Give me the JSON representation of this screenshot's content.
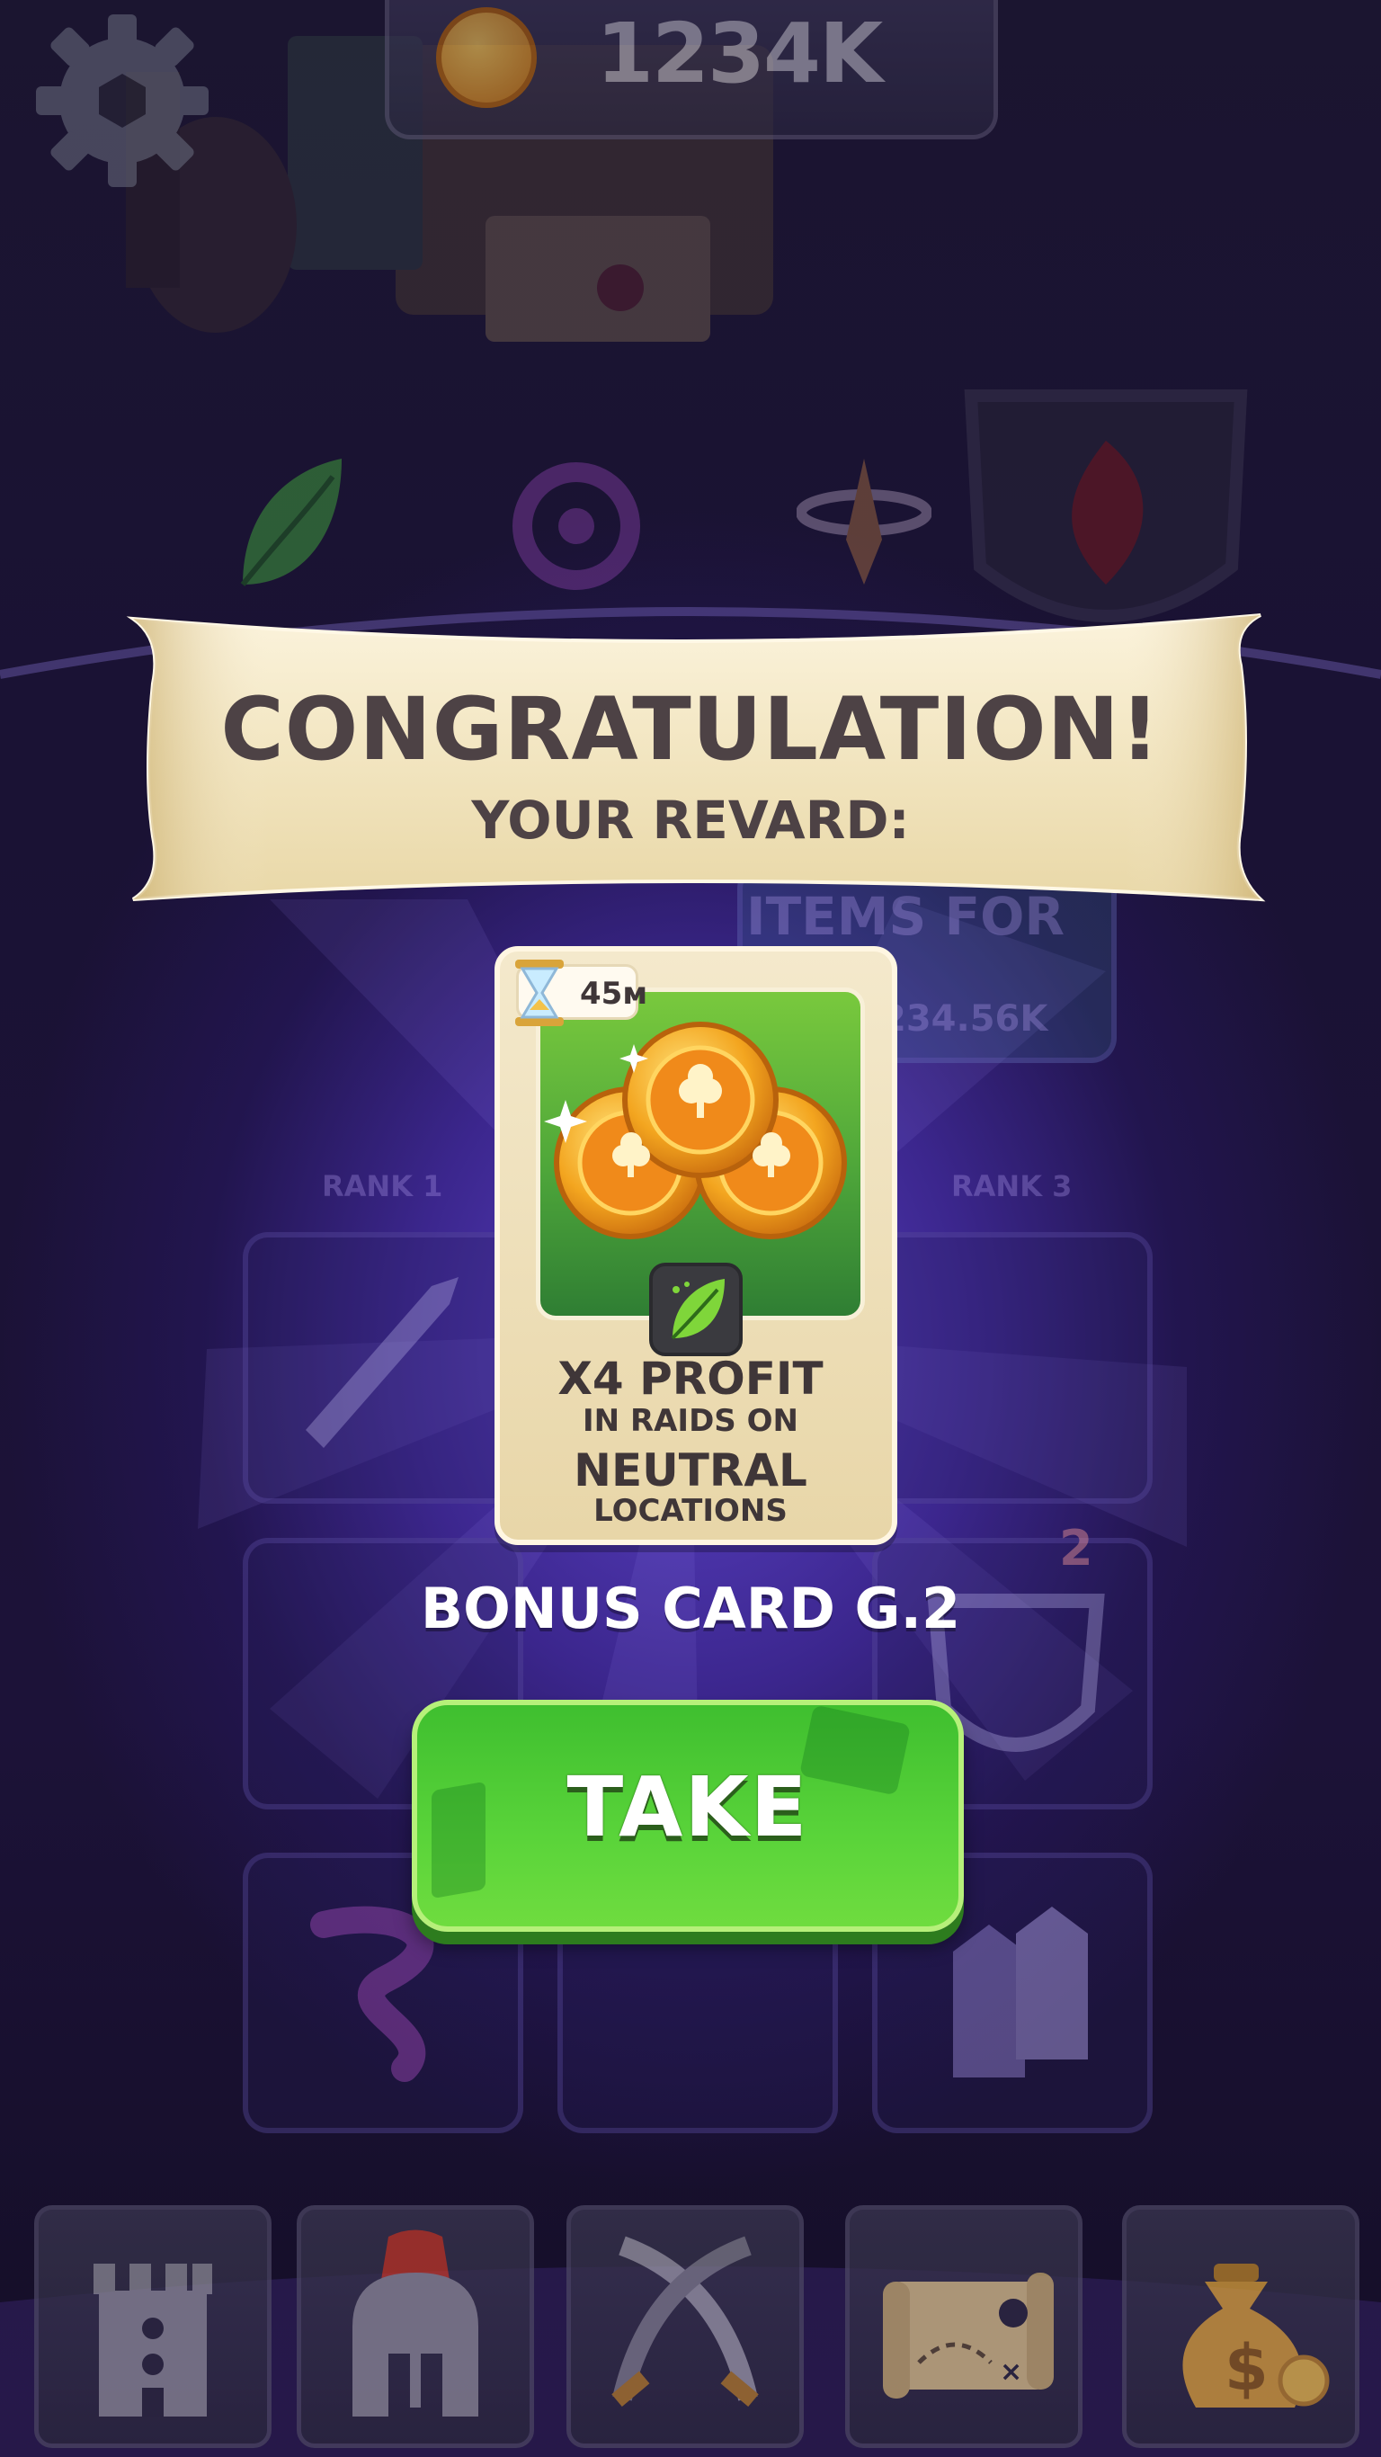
{
  "top_bar": {
    "currency_amount": "1234K",
    "icons": [
      "settings-gear-icon",
      "gold-coin-icon"
    ]
  },
  "background": {
    "item_text": "ITEMS FOR",
    "item_price": "234.56K",
    "ranks": [
      "RANK 1",
      "RANK 3"
    ],
    "slot_badge": "2"
  },
  "banner": {
    "title": "CONGRATULATION!",
    "subtitle": "YOUR REVARD:"
  },
  "card": {
    "timer": "45м",
    "line1": "X4 PROFIT",
    "line2": "IN RAIDS ON",
    "line3": "NEUTRAL",
    "line4": "LOCATIONS",
    "icons": [
      "hourglass-icon",
      "gold-coins-icon",
      "leaf-icon"
    ]
  },
  "reward_name": "BONUS CARD G.2",
  "take_button": {
    "label": "TAKE"
  },
  "nav": {
    "items": [
      "castle-icon",
      "spartan-helmet-icon",
      "crossed-swords-icon",
      "treasure-map-icon",
      "money-bag-icon"
    ]
  },
  "colors": {
    "banner_text": "#4d4245",
    "take_button": "#5ad43a",
    "card_art": "#4ea63a"
  }
}
